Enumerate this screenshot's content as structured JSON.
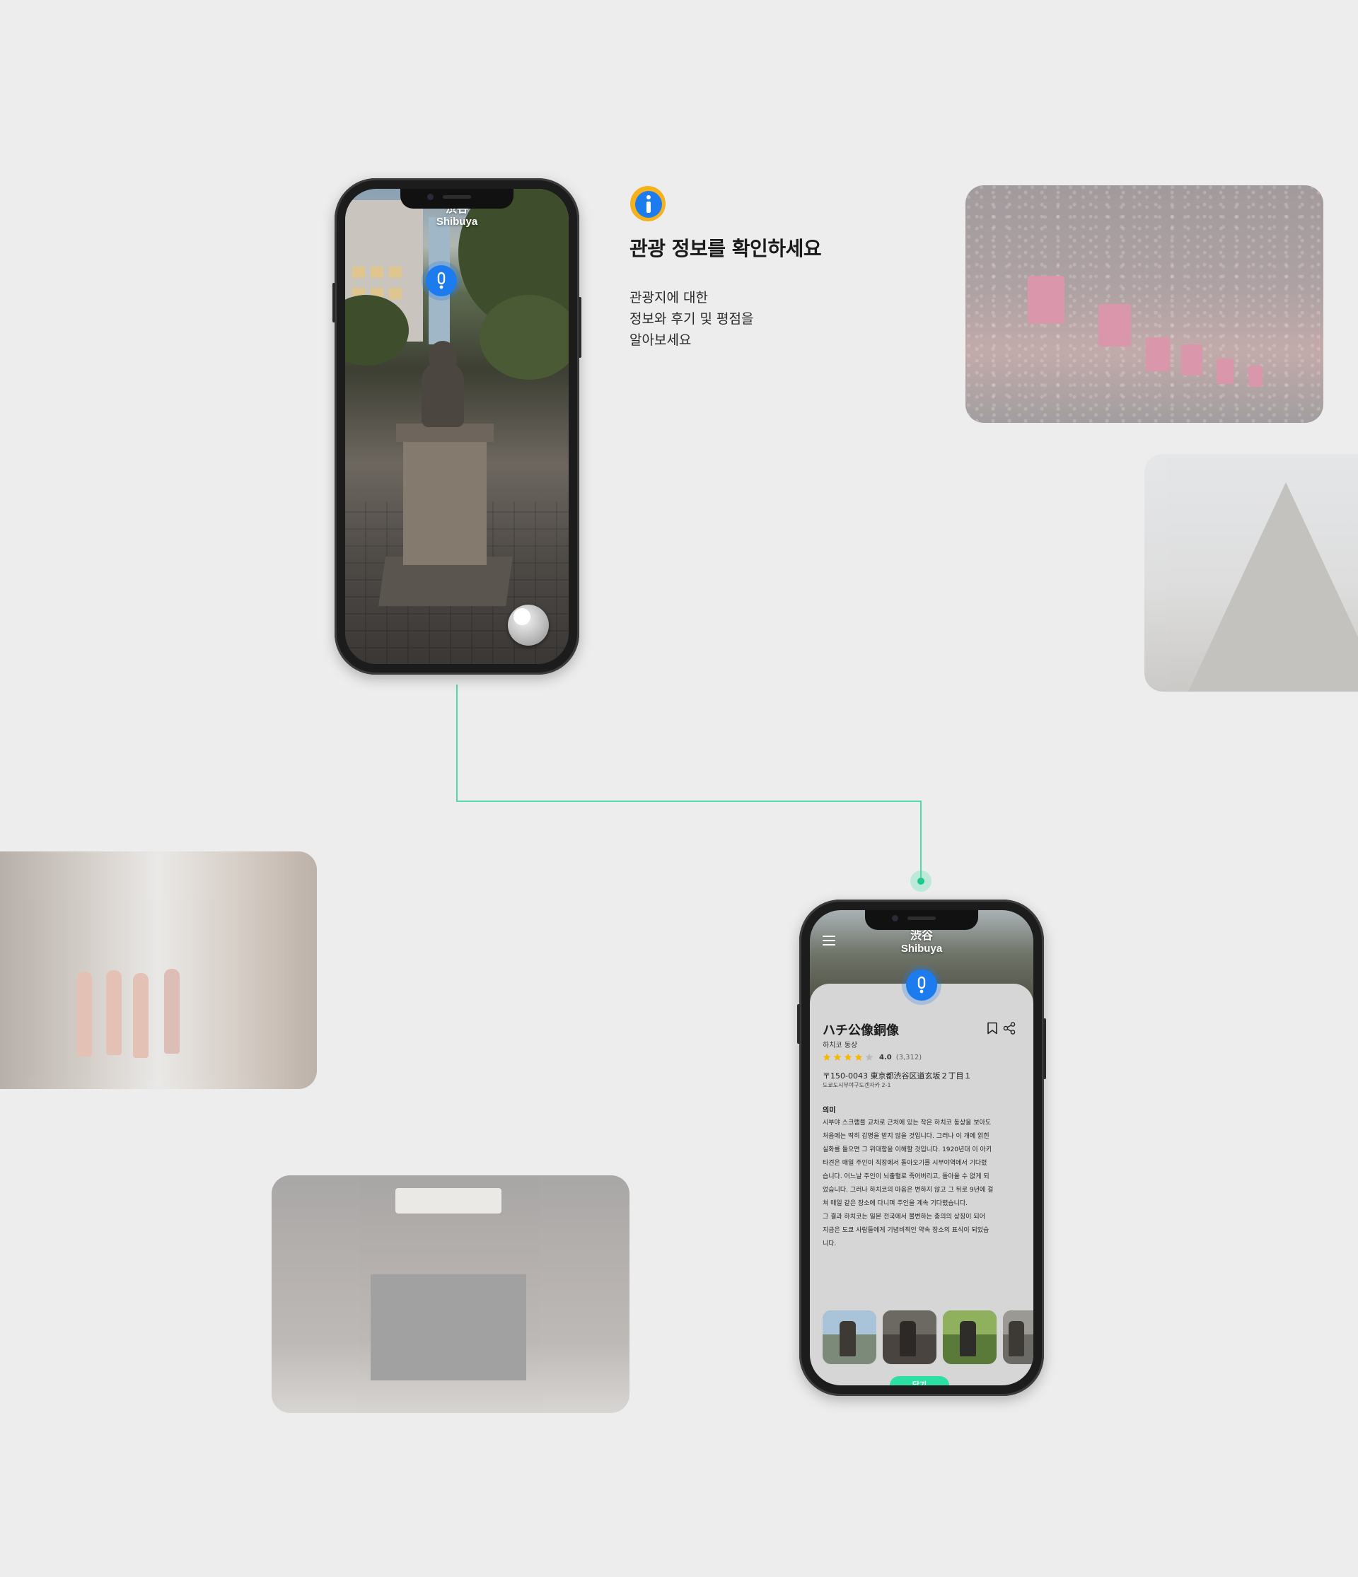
{
  "colors": {
    "background": "#ededed",
    "accent_green": "#2be0a0",
    "pin_blue": "#1d7bf0",
    "star_yellow": "#f5b800"
  },
  "info": {
    "icon": "info-icon",
    "title": "관광 정보를 확인하세요",
    "body": "관광지에 대한\n정보와 후기 및 평점을\n알아보세요"
  },
  "camera_screen": {
    "location_jp": "渋谷",
    "location_en": "Shibuya",
    "pin_icon": "exclamation-icon"
  },
  "detail_screen": {
    "location_jp": "渋谷",
    "location_en": "Shibuya",
    "menu_icon": "hamburger-menu-icon",
    "title": "ハチ公像銅像",
    "subtitle": "하치코 동상",
    "rating": 4,
    "rating_value": "4.0",
    "rating_count": "(3,312)",
    "address": "〒150-0043 東京都渋谷区道玄坂２丁目１",
    "address_kr": "도쿄도시부야구도겐자카 2-1",
    "section_title": "의미",
    "description": "시부야 스크램블 교차로 근처에 있는 작은 하치코 동상을 보아도\n처음에는 딱히 감명을 받지 않을 것입니다. 그러나 이 개에 얽힌\n실화를 들으면 그 위대함을 이해할 것입니다. 1920년대 이 아키\n타견은 매일 주인이 직장에서 돌아오기를 시부야역에서 기다렸\n습니다. 어느날 주인이 뇌출혈로 죽어버리고, 돌아올 수 없게 되\n었습니다. 그러나 하치코의 마음은 변하지 않고 그 뒤로 9년에 걸\n쳐 매일 같은 장소에 다니며 주인을 계속 기다렸습니다.\n 그 결과 하치코는 일본 전국에서 불변하는 충의의 상징이 되어\n지금은 도쿄 사람들에게 기념비적인 약속 장소의 표식이 되었습\n니다.",
    "close_label": "닫기",
    "bookmark_icon": "bookmark-icon",
    "share_icon": "share-icon"
  }
}
